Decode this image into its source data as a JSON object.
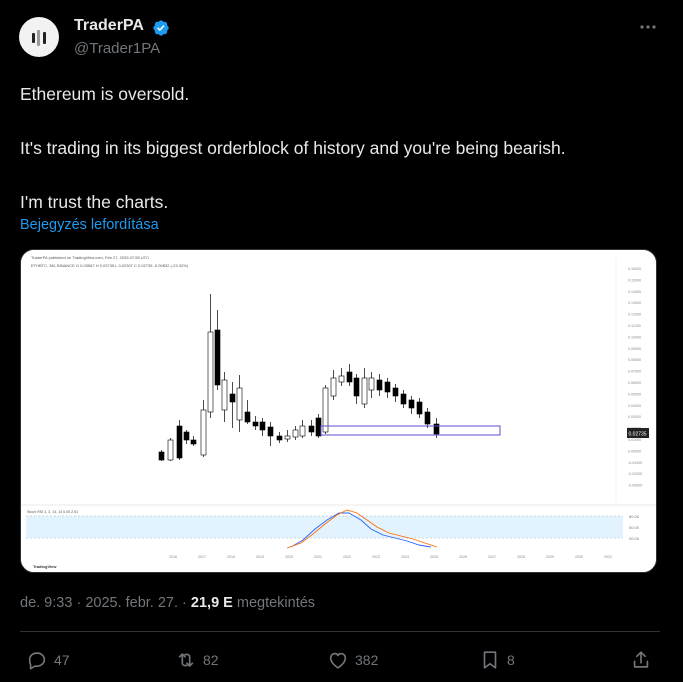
{
  "tweet": {
    "author_name": "TraderPA",
    "author_handle": "@Trader1PA",
    "text_lines": [
      "Ethereum is oversold.",
      "It's trading in its biggest orderblock of history and you're being bearish.",
      "I'm trust the charts."
    ],
    "translate_label": "Bejegyzés lefordítása",
    "time": "de. 9:33",
    "date": "2025. febr. 27.",
    "views_count": "21,9 E",
    "views_label": "megtekintés"
  },
  "chart_image": {
    "header": "TraderPA published on TradingView.com, Feb 27, 2025 07:55 UTC",
    "symbol_line": "ETHBTC, 3M, BINANCE  O 0.03587  H 0.03735  L 0.02307  C 0.02735  -0.00832 (-23.32%)",
    "price_labels": [
      "0.16000",
      "0.15000",
      "0.14000",
      "0.13000",
      "0.12000",
      "0.11000",
      "0.10000",
      "0.09000",
      "0.08000",
      "0.07000",
      "0.06000",
      "0.05000",
      "0.04000",
      "0.03000",
      "0.02000",
      "0.01000",
      "0.00000",
      "-0.01000",
      "-0.02000",
      "-0.03000"
    ],
    "current_price": "0.02735",
    "rsi_label": "Stoch RSI 3, 3, 14, 14   0.00  2.51",
    "rsi_levels": [
      "80.00",
      "50.00",
      "20.00"
    ],
    "year_labels": [
      "2016",
      "2017",
      "2018",
      "2019",
      "2020",
      "2021",
      "2022",
      "2023",
      "2024",
      "2025",
      "2026",
      "2027",
      "2028",
      "2029",
      "2030",
      "2031"
    ],
    "logo_text": "TradingView",
    "colors": {
      "up": "#ffffff",
      "down": "#000000",
      "orderblock": "#5b4fd1",
      "stoch_k": "#2962ff",
      "stoch_d": "#ff6d00"
    }
  },
  "actions": {
    "replies": "47",
    "reposts": "82",
    "likes": "382",
    "bookmarks": "8"
  },
  "icons": [
    "verified-badge-icon",
    "more-icon",
    "reply-icon",
    "repost-icon",
    "like-icon",
    "bookmark-icon",
    "share-icon"
  ]
}
